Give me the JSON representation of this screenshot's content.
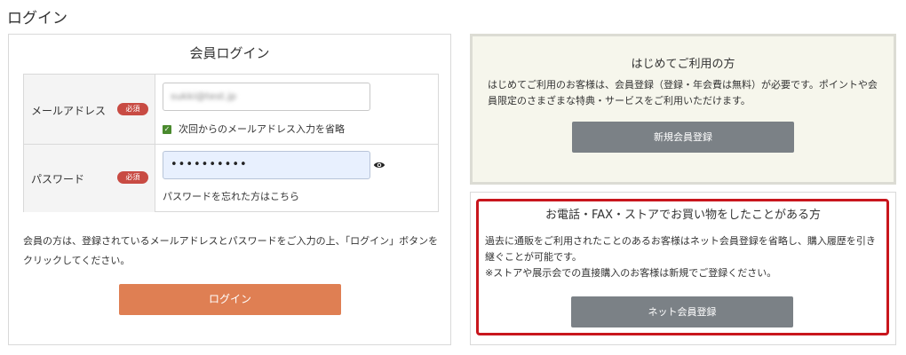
{
  "page": {
    "title": "ログイン"
  },
  "member_login": {
    "heading": "会員ログイン",
    "email": {
      "label": "メールアドレス",
      "badge": "必須",
      "value": "sukki@test.jp",
      "remember_label": "次回からのメールアドレス入力を省略",
      "remember_checked": true
    },
    "password": {
      "label": "パスワード",
      "badge": "必須",
      "value": "••••••••••",
      "forgot_link": "パスワードを忘れた方はこちら"
    },
    "description": "会員の方は、登録されているメールアドレスとパスワードをご入力の上、「ログイン」ボタンをクリックしてください。",
    "login_button": "ログイン"
  },
  "first_time": {
    "heading": "はじめてご利用の方",
    "text": "はじめてご利用のお客様は、会員登録（登録・年会費は無料）が必要です。ポイントや会員限定のさまざまな特典・サービスをご利用いただけます。",
    "register_button": "新規会員登録"
  },
  "phone_fax": {
    "heading": "お電話・FAX・ストアでお買い物をしたことがある方",
    "text_line1": "過去に通販をご利用されたことのあるお客様はネット会員登録を省略し、購入履歴を引き継ぐことが可能です。",
    "text_line2": "※ストアや展示会での直接購入のお客様は新規でご登録ください。",
    "net_button": "ネット会員登録"
  },
  "colors": {
    "login_button": "#df7f53",
    "badge": "#c84b43",
    "gray_button": "#7b8186",
    "highlight": "#c8161d"
  }
}
